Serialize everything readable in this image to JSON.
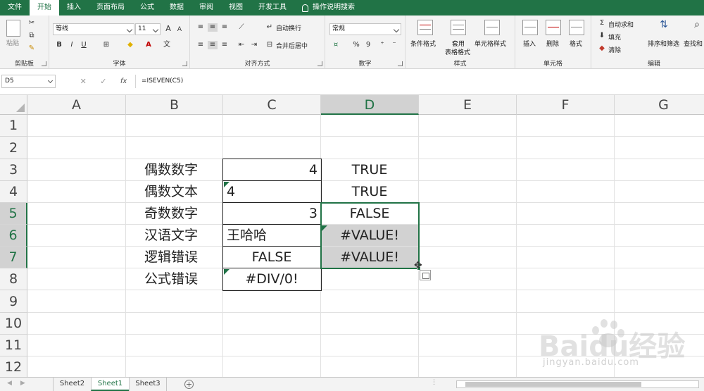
{
  "tabs": [
    "文件",
    "开始",
    "插入",
    "页面布局",
    "公式",
    "数据",
    "审阅",
    "视图",
    "开发工具"
  ],
  "active_tab": "开始",
  "tell_me": "操作说明搜索",
  "ribbon": {
    "clipboard": {
      "paste": "粘贴",
      "label": "剪贴板"
    },
    "font": {
      "name": "等线",
      "size": "11",
      "label": "字体",
      "bold": "B",
      "italic": "I",
      "underline": "U",
      "grow": "A",
      "shrink": "A"
    },
    "alignment": {
      "wrap": "自动换行",
      "merge": "合并后居中",
      "label": "对齐方式"
    },
    "number": {
      "format": "常规",
      "percent": "%",
      "comma": "9",
      "label": "数字"
    },
    "styles": {
      "conditional": "条件格式",
      "table_line1": "套用",
      "table_line2": "表格格式",
      "cell_styles": "单元格样式",
      "label": "样式"
    },
    "cells": {
      "insert": "插入",
      "delete": "删除",
      "format": "格式",
      "label": "单元格"
    },
    "editing": {
      "autosum": "自动求和",
      "fill": "填充",
      "clear": "清除",
      "sort": "排序和筛选",
      "find": "查找和",
      "label": "编辑"
    }
  },
  "formula_bar": {
    "name_box": "D5",
    "cancel": "✕",
    "enter": "✓",
    "fx": "fx",
    "formula": "=ISEVEN(C5)"
  },
  "columns": [
    "A",
    "B",
    "C",
    "D",
    "E",
    "F",
    "G"
  ],
  "rows": [
    "1",
    "2",
    "3",
    "4",
    "5",
    "6",
    "7",
    "8",
    "9",
    "10",
    "11",
    "12"
  ],
  "cells": {
    "B3": "偶数数字",
    "C3": "4",
    "D3": "TRUE",
    "B4": "偶数文本",
    "C4": "4",
    "D4": "TRUE",
    "B5": "奇数数字",
    "C5": "3",
    "D5": "FALSE",
    "B6": "汉语文字",
    "C6": "王哈哈",
    "D6": "#VALUE!",
    "B7": "逻辑错误",
    "C7": "FALSE",
    "D7": "#VALUE!",
    "B8": "公式错误",
    "C8": "#DIV/0!"
  },
  "sheets": [
    "Sheet2",
    "Sheet1",
    "Sheet3"
  ],
  "active_sheet": "Sheet1",
  "watermark": {
    "main": "Baidu经验",
    "sub": "jingyan.baidu.com"
  },
  "colors": {
    "excel_green": "#217346",
    "selection_gray": "#d2d2d2"
  }
}
